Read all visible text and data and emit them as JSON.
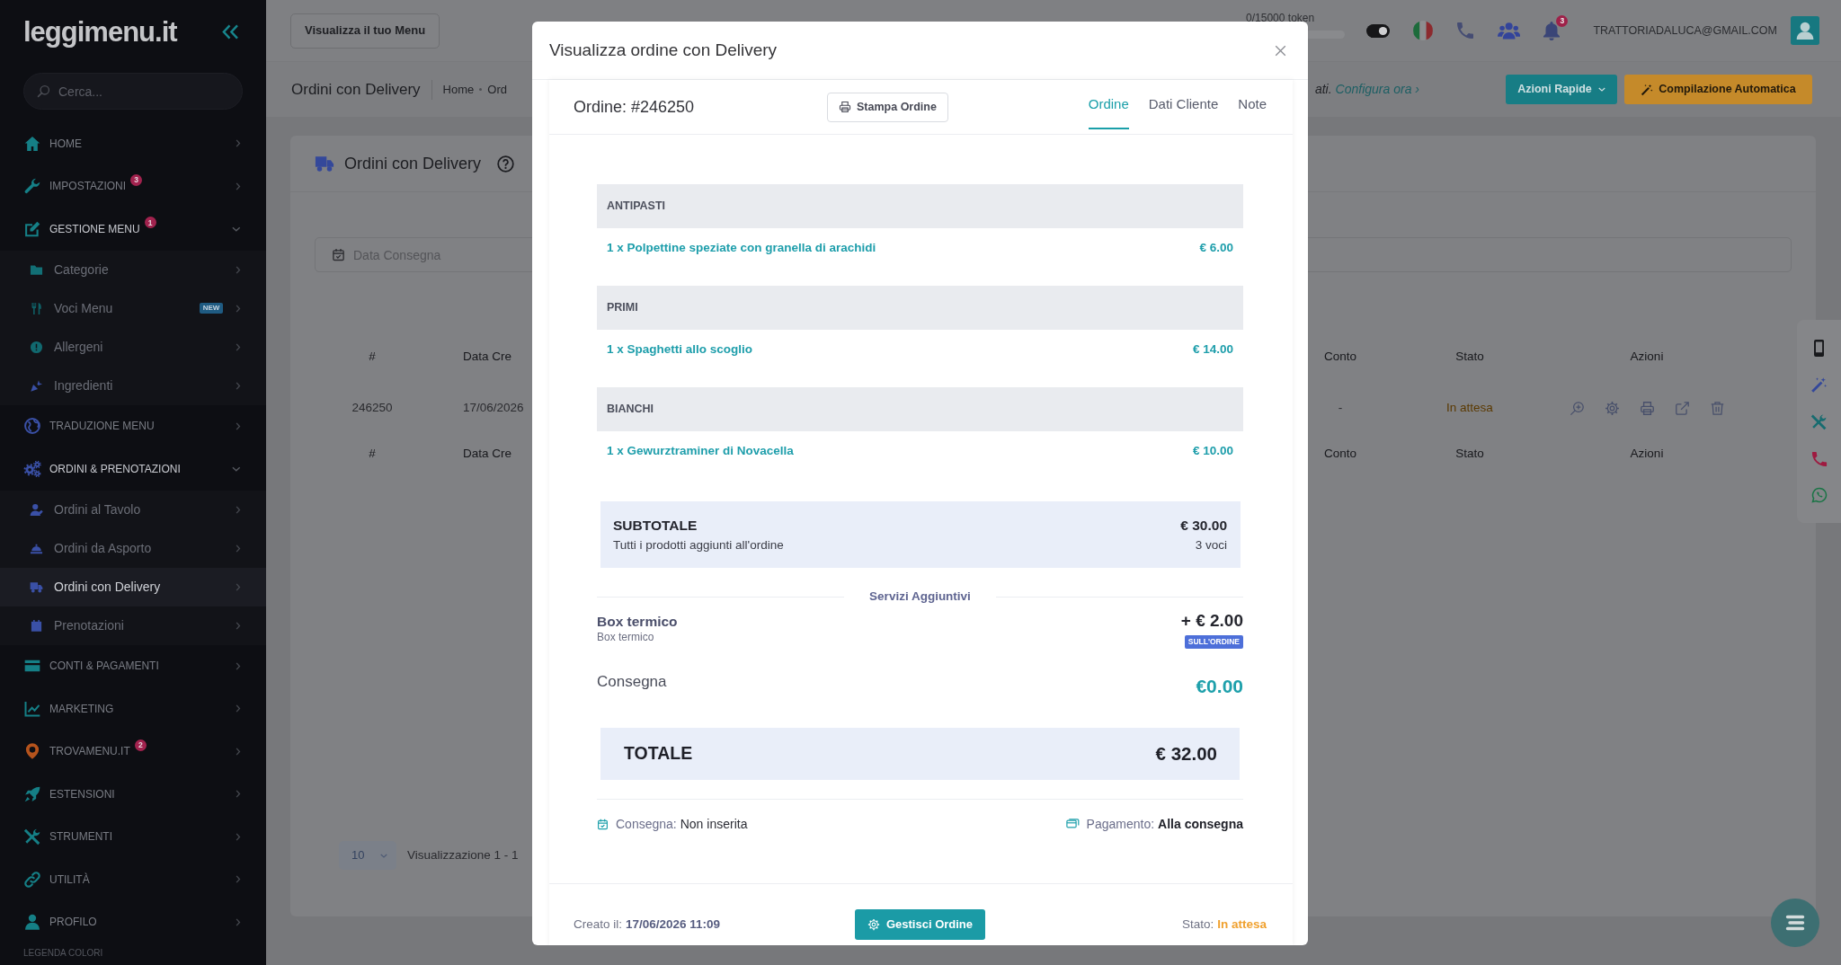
{
  "sidebar": {
    "logo": "leggimenu.it",
    "search": {
      "placeholder": "Cerca..."
    },
    "items": [
      {
        "label": "HOME",
        "selected": false,
        "expanded": false
      },
      {
        "label": "IMPOSTAZIONI",
        "selected": false,
        "expanded": false,
        "badge": {
          "kind": "count",
          "text": "3"
        }
      },
      {
        "label": "GESTIONE MENU",
        "selected": false,
        "expanded": true,
        "badge": {
          "kind": "count",
          "text": "1"
        },
        "children": [
          {
            "label": "Categorie",
            "selected": false
          },
          {
            "label": "Voci Menu",
            "selected": false,
            "badge": {
              "kind": "tag",
              "text": "NEW"
            }
          },
          {
            "label": "Allergeni",
            "selected": false
          },
          {
            "label": "Ingredienti",
            "selected": false
          }
        ]
      },
      {
        "label": "TRADUZIONE MENU",
        "selected": false,
        "expanded": false
      },
      {
        "label": "ORDINI & PRENOTAZIONI",
        "selected": false,
        "expanded": true,
        "children": [
          {
            "label": "Ordini al Tavolo",
            "selected": false
          },
          {
            "label": "Ordini da Asporto",
            "selected": false
          },
          {
            "label": "Ordini con Delivery",
            "selected": true
          },
          {
            "label": "Prenotazioni",
            "selected": false
          }
        ]
      },
      {
        "label": "CONTI & PAGAMENTI",
        "selected": false,
        "expanded": false
      },
      {
        "label": "MARKETING",
        "selected": false,
        "expanded": false
      },
      {
        "label": "TROVAMENU.IT",
        "selected": false,
        "expanded": false,
        "badge": {
          "kind": "count",
          "text": "2"
        }
      },
      {
        "label": "ESTENSIONI",
        "selected": false,
        "expanded": false
      },
      {
        "label": "STRUMENTI",
        "selected": false,
        "expanded": false
      },
      {
        "label": "UTILITÀ",
        "selected": false,
        "expanded": false
      },
      {
        "label": "PROFILO",
        "selected": false,
        "expanded": false
      }
    ],
    "legend": "LEGENDA COLORI"
  },
  "topbar": {
    "view_menu_button": "Visualizza il tuo Menu",
    "tokens": {
      "label": "0/15000 token",
      "level": 0
    },
    "notifications": "3",
    "account": "TRATTORIADALUCA@GMAIL.COM"
  },
  "page_header": {
    "title": "Ordini con Delivery",
    "breadcrumb": [
      "Home",
      "Ord"
    ],
    "notice": {
      "text": "ati.",
      "link": "Configura ora ›"
    },
    "buttons": [
      {
        "kind": "dropdown",
        "label": "Azioni Rapide"
      },
      {
        "kind": "magic",
        "label": "Compilazione Automatica"
      }
    ]
  },
  "orders_card": {
    "title": "Ordini con Delivery",
    "date_filter": {
      "placeholder": "Data Consegna"
    },
    "table": {
      "columns": [
        "#",
        "Data Cre",
        "Conto",
        "Stato",
        "Azioni"
      ],
      "rows": [
        {
          "cells": [
            "246250",
            "17/06/2026",
            "-",
            "In attesa"
          ]
        }
      ],
      "footer_columns": [
        "#",
        "Data Cre",
        "Conto",
        "Stato",
        "Azioni"
      ]
    },
    "pagination": {
      "page_size": "10",
      "info": "Visualizzazione 1 - 1"
    }
  },
  "modal": {
    "title": "Visualizza ordine con Delivery",
    "order_number": "Ordine: #246250",
    "print_button": "Stampa Ordine",
    "tabs": [
      {
        "label": "Ordine",
        "selected": true
      },
      {
        "label": "Dati Cliente",
        "selected": false
      },
      {
        "label": "Note",
        "selected": false
      }
    ],
    "categories": [
      {
        "name": "ANTIPASTI",
        "items": [
          {
            "name": "1 x Polpettine speziate con granella di arachidi",
            "price": "€ 6.00"
          }
        ]
      },
      {
        "name": "PRIMI",
        "items": [
          {
            "name": "1 x Spaghetti allo scoglio",
            "price": "€ 14.00"
          }
        ]
      },
      {
        "name": "BIANCHI",
        "items": [
          {
            "name": "1 x Gewurztraminer di Novacella",
            "price": "€ 10.00"
          }
        ]
      }
    ],
    "subtotal": {
      "label": "SUBTOTALE",
      "note": "Tutti i prodotti aggiunti all'ordine",
      "amount": "€ 30.00",
      "count": "3 voci"
    },
    "services": {
      "heading": "Servizi Aggiuntivi",
      "items": [
        {
          "name": "Box termico",
          "description": "Box termico",
          "price": "+ € 2.00",
          "tag": "SULL'ORDINE"
        }
      ]
    },
    "delivery_fee": {
      "label": "Consegna",
      "amount": "€0.00"
    },
    "total": {
      "label": "TOTALE",
      "amount": "€ 32.00"
    },
    "delivery": {
      "label": "Consegna:",
      "value": "Non inserita"
    },
    "payment": {
      "label": "Pagamento:",
      "value": "Alla consegna"
    },
    "created": {
      "label": "Creato il:",
      "value": "17/06/2026 11:09"
    },
    "manage_button": "Gestisci Ordine",
    "status": {
      "label": "Stato:",
      "value": "In attesa"
    }
  }
}
